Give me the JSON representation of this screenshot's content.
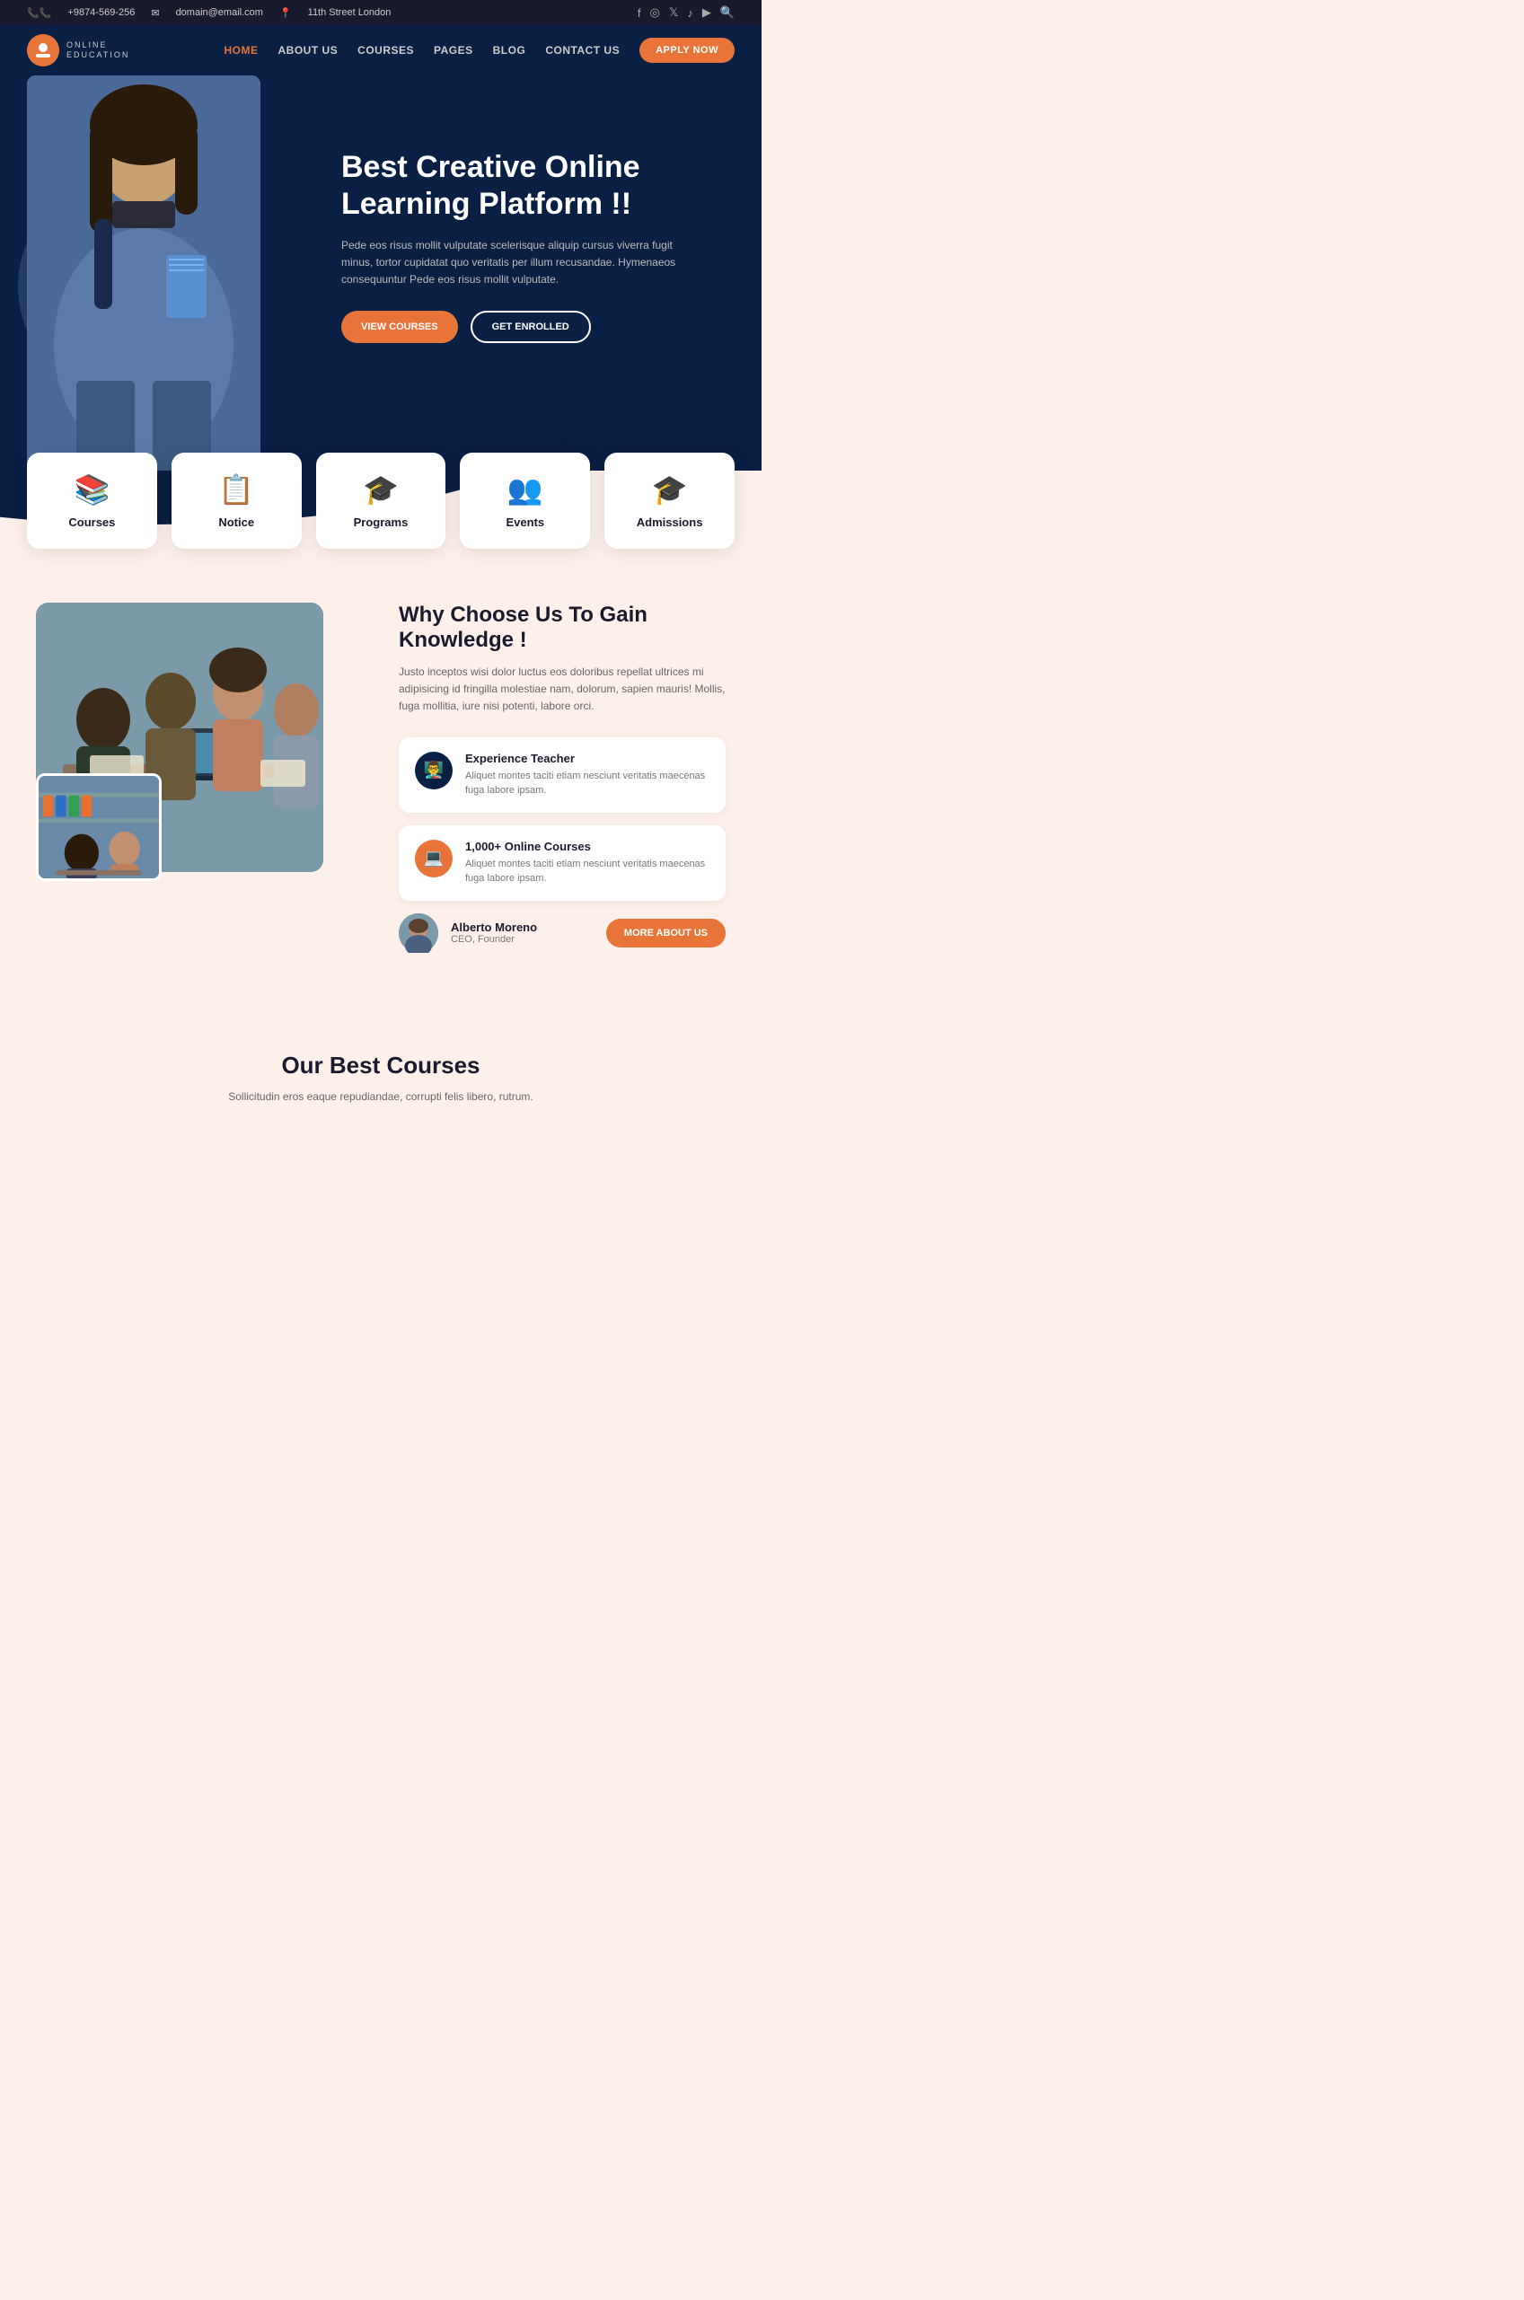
{
  "topbar": {
    "phone": "+9874-569-256",
    "email": "domain@email.com",
    "address": "11th Street London"
  },
  "nav": {
    "logo_text": "ONLINE",
    "logo_sub": "EDUCATION",
    "links": [
      {
        "label": "HOME",
        "active": true
      },
      {
        "label": "ABOUT US",
        "active": false
      },
      {
        "label": "COURSES",
        "active": false
      },
      {
        "label": "PAGES",
        "active": false,
        "dropdown": true
      },
      {
        "label": "BLOG",
        "active": false
      },
      {
        "label": "CONTACT US",
        "active": false
      }
    ],
    "cta": "APPLY NOW"
  },
  "hero": {
    "title": "Best Creative Online Learning Platform !!",
    "description": "Pede eos risus mollit vulputate scelerisque aliquip cursus viverra fugit minus, tortor cupidatat quo veritatis per illum recusandae. Hymenaeos consequuntur Pede eos risus mollit vulputate.",
    "btn1": "VIEW COURSES",
    "btn2": "GET ENROLLED"
  },
  "features": [
    {
      "icon": "📚",
      "label": "Courses"
    },
    {
      "icon": "📋",
      "label": "Notice"
    },
    {
      "icon": "🎓",
      "label": "Programs"
    },
    {
      "icon": "👥",
      "label": "Events"
    },
    {
      "icon": "🎓",
      "label": "Admissions"
    }
  ],
  "why": {
    "title": "Why Choose Us To Gain Knowledge !",
    "description": "Justo inceptos wisi dolor luctus eos doloribus repellat ultrices mi adipisicing id fringilla molestiae nam, dolorum, sapien mauris! Mollis, fuga mollitia, iure nisi potenti, labore orci.",
    "items": [
      {
        "icon": "👨‍🏫",
        "icon_style": "dark",
        "title": "Experience Teacher",
        "text": "Aliquet montes taciti etiam nesciunt veritatis maecenas fuga labore ipsam."
      },
      {
        "icon": "💻",
        "icon_style": "orange",
        "title": "1,000+ Online Courses",
        "text": "Aliquet montes taciti etiam nesciunt veritatis maecenas fuga labore ipsam."
      }
    ],
    "ceo_name": "Alberto Moreno",
    "ceo_role": "CEO, Founder",
    "more_btn": "MORE ABOUT US"
  },
  "courses": {
    "title": "Our Best Courses",
    "description": "Sollicitudin eros eaque repudiandae, corrupti felis libero, rutrum."
  }
}
